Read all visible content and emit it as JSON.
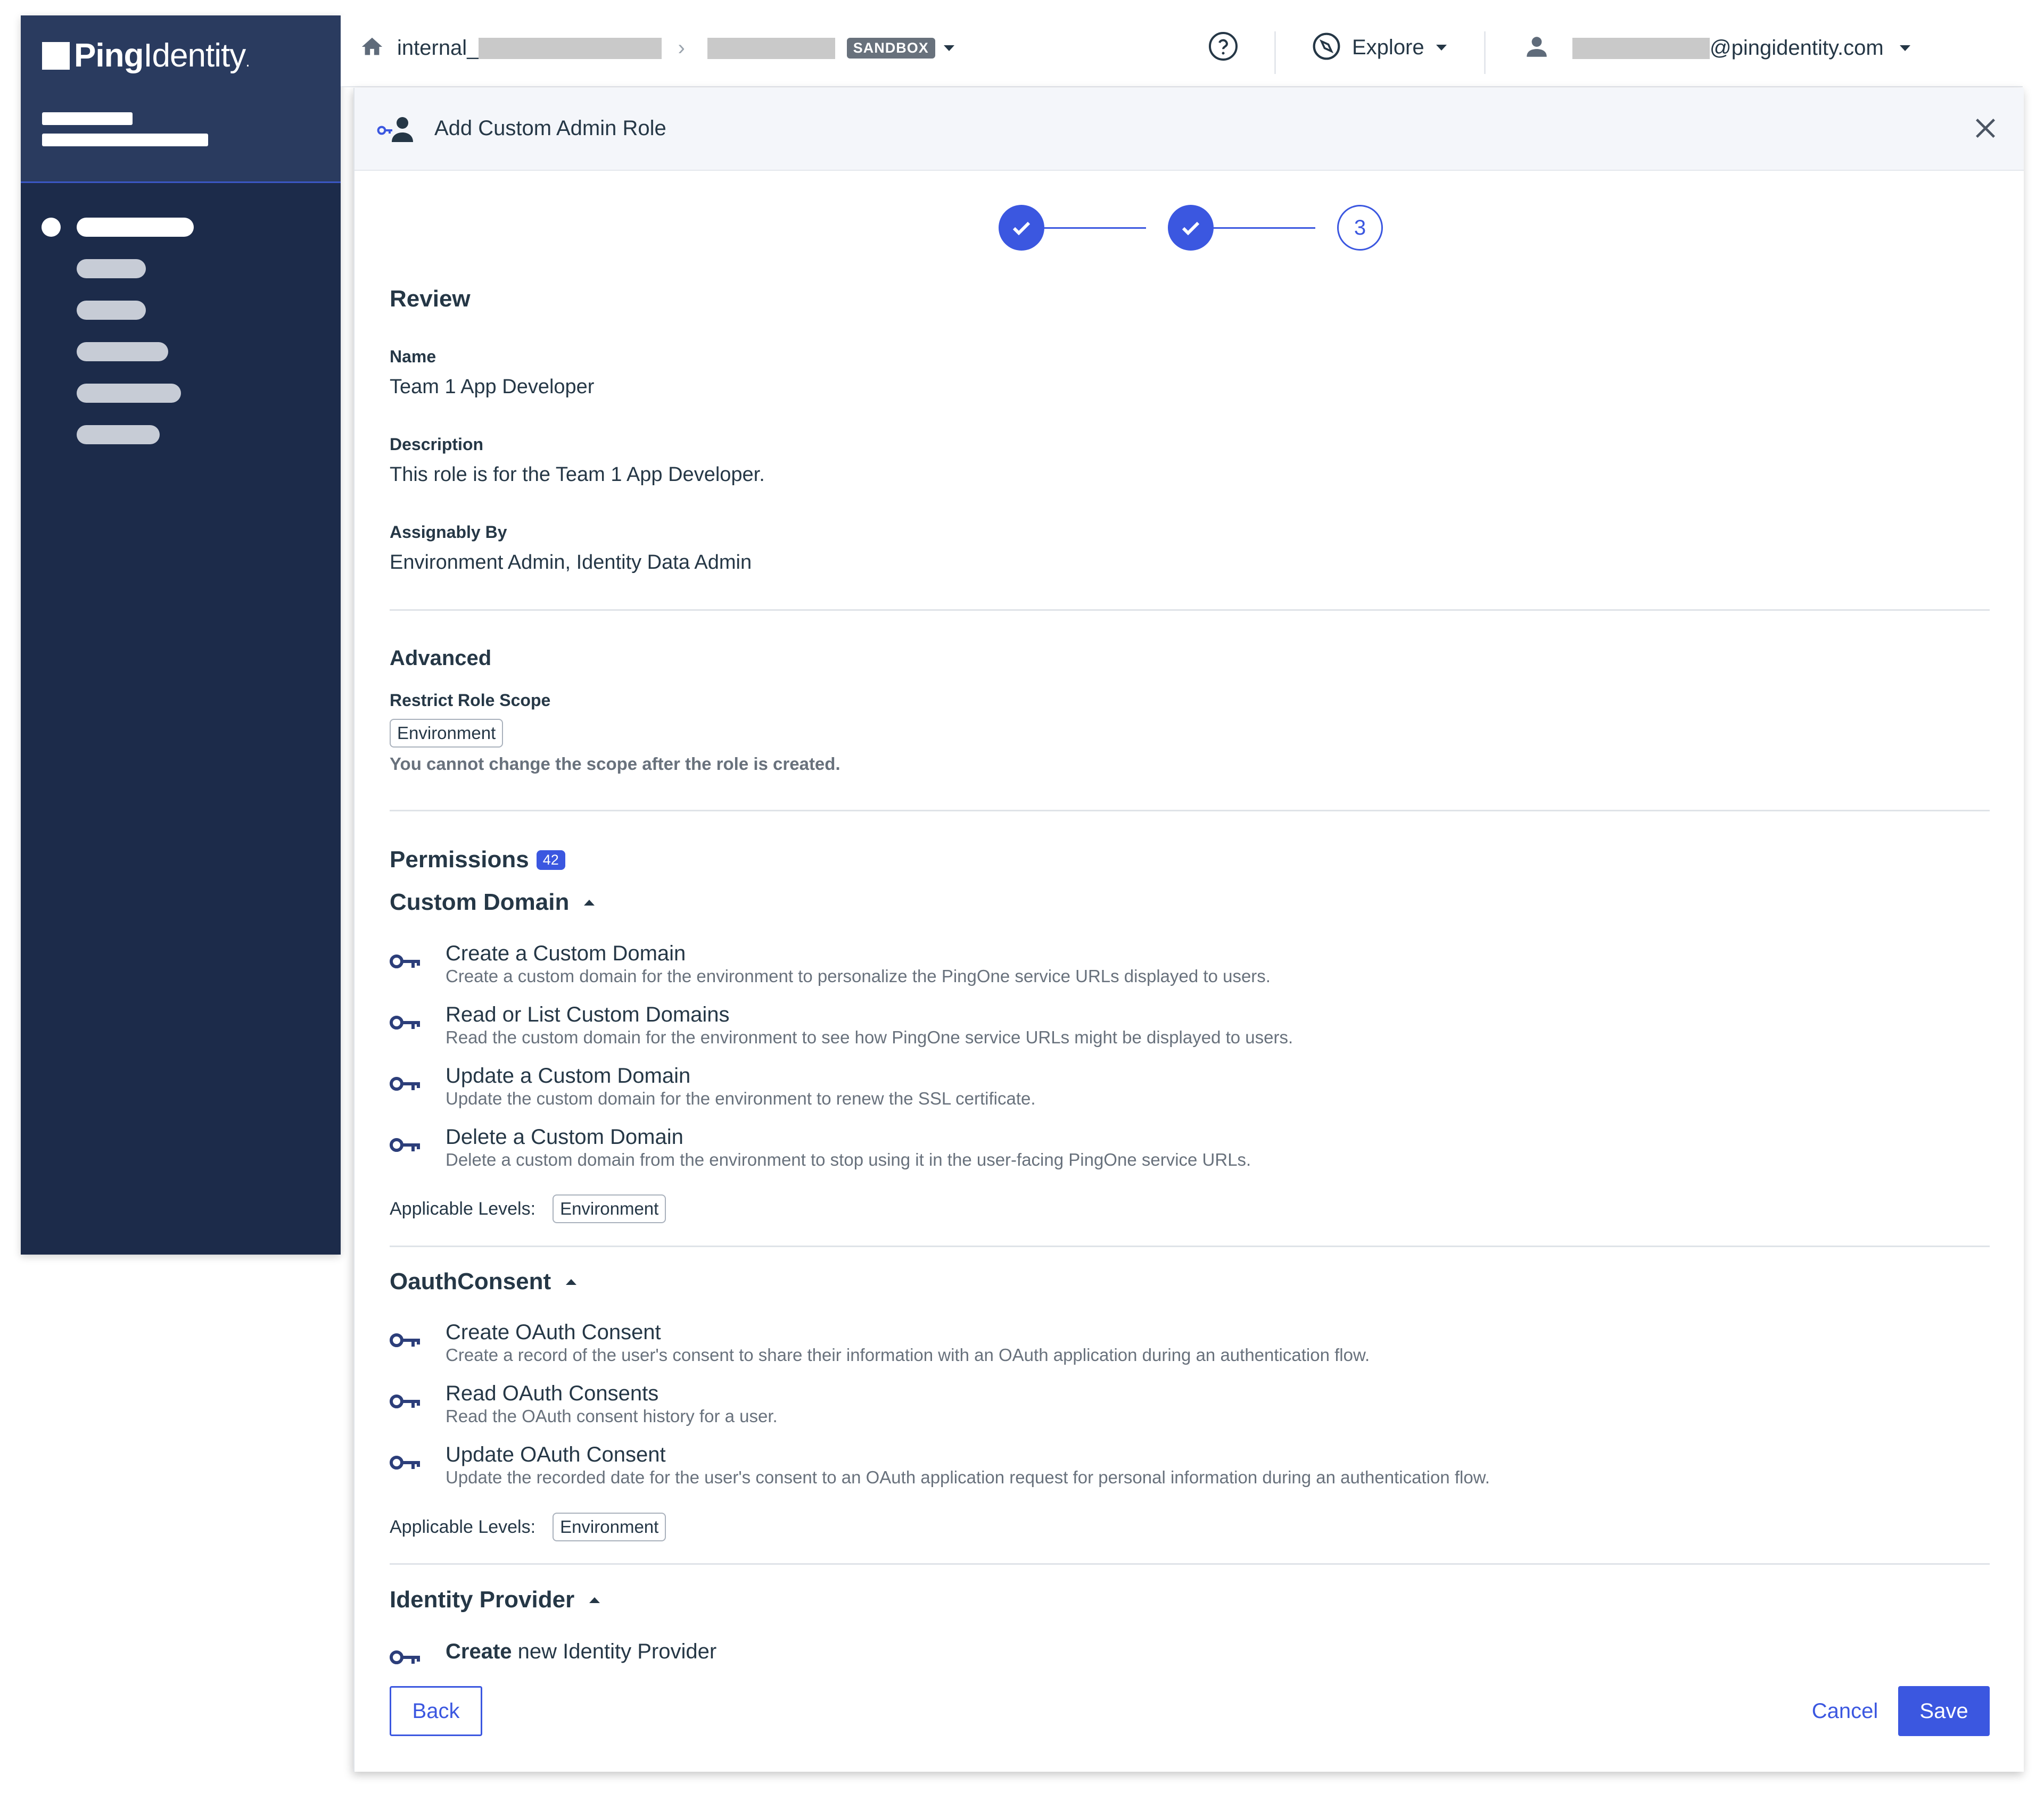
{
  "brand": {
    "logo_bold": "Ping",
    "logo_light": "Identity",
    "logo_mark": "."
  },
  "breadcrumb": {
    "org_prefix": "internal_",
    "separator": "›",
    "environment_badge": "SANDBOX"
  },
  "topbar": {
    "explore_label": "Explore",
    "user_email_suffix": "@pingidentity.com"
  },
  "modal": {
    "title": "Add Custom Admin Role",
    "steps": [
      {
        "state": "complete"
      },
      {
        "state": "complete"
      },
      {
        "state": "current",
        "label": "3"
      }
    ]
  },
  "review": {
    "heading": "Review",
    "name_label": "Name",
    "name_value": "Team 1 App Developer",
    "description_label": "Description",
    "description_value": "This role is for the Team 1 App Developer.",
    "assignable_label": "Assignably By",
    "assignable_value": "Environment Admin, Identity Data Admin"
  },
  "advanced": {
    "heading": "Advanced",
    "scope_label": "Restrict Role Scope",
    "scope_value": "Environment",
    "scope_note": "You cannot change the scope after the role is created."
  },
  "permissions": {
    "heading": "Permissions",
    "count": "42",
    "applicable_label": "Applicable Levels:",
    "groups": [
      {
        "name": "Custom Domain",
        "level": "Environment",
        "items": [
          {
            "title": "Create a Custom Domain",
            "desc": "Create a custom domain for the environment to personalize the PingOne service URLs displayed to users."
          },
          {
            "title": "Read or List Custom Domains",
            "desc": "Read the custom domain for the environment to see how PingOne service URLs might be displayed to users."
          },
          {
            "title": "Update a Custom Domain",
            "desc": "Update the custom domain for the environment to renew the SSL certificate."
          },
          {
            "title": "Delete a Custom Domain",
            "desc": "Delete a custom domain from the environment to stop using it in the user-facing PingOne service URLs."
          }
        ]
      },
      {
        "name": "OauthConsent",
        "level": "Environment",
        "items": [
          {
            "title": "Create OAuth Consent",
            "desc": "Create a record of the user's consent to share their information with an OAuth application during an authentication flow."
          },
          {
            "title": "Read OAuth Consents",
            "desc": "Read the OAuth consent history for a user."
          },
          {
            "title": "Update OAuth Consent",
            "desc": "Update the recorded date for the user's consent to an OAuth application request for personal information during an authentication flow."
          }
        ]
      },
      {
        "name": "Identity Provider",
        "items": [
          {
            "title_bold": "Create",
            "title_rest": " new Identity Provider"
          }
        ]
      }
    ]
  },
  "footer": {
    "back_label": "Back",
    "cancel_label": "Cancel",
    "save_label": "Save"
  },
  "colors": {
    "sidebar_bg": "#1c2b4a",
    "accent": "#3b57e0",
    "text": "#253746",
    "muted": "#68717c"
  },
  "icons": [
    "home-icon",
    "chevron-right-icon",
    "caret-down-icon",
    "help-icon",
    "explore-compass-icon",
    "user-icon",
    "admin-role-icon",
    "close-icon",
    "check-icon",
    "key-icon",
    "caret-up-icon"
  ]
}
